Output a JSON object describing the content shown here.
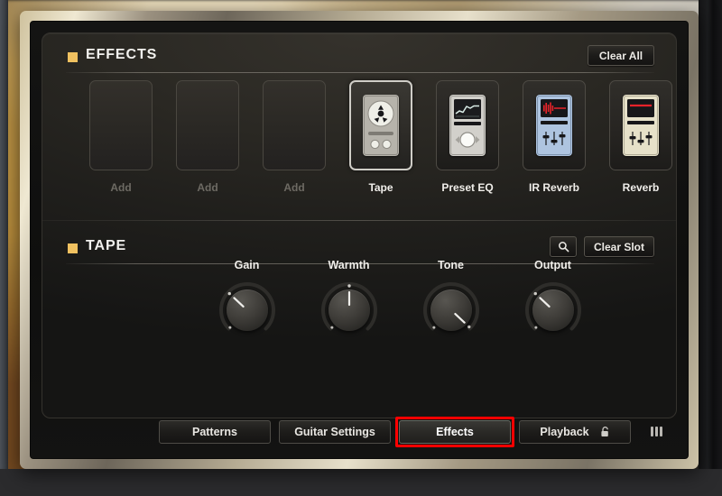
{
  "window": {
    "frame_color": "#cfc29e",
    "panel_bg": "#141413"
  },
  "effects_section": {
    "bullet_color": "#f0c160",
    "title": "EFFECTS",
    "clear_all_label": "Clear All",
    "slots": [
      {
        "label": "Add",
        "state": "empty",
        "icon": "empty-slot-icon"
      },
      {
        "label": "Add",
        "state": "empty",
        "icon": "empty-slot-icon"
      },
      {
        "label": "Add",
        "state": "empty",
        "icon": "empty-slot-icon"
      },
      {
        "label": "Tape",
        "state": "selected",
        "icon": "tape-pedal-icon"
      },
      {
        "label": "Preset EQ",
        "state": "filled",
        "icon": "preset-eq-pedal-icon"
      },
      {
        "label": "IR Reverb",
        "state": "filled",
        "icon": "ir-reverb-pedal-icon"
      },
      {
        "label": "Reverb",
        "state": "filled",
        "icon": "reverb-pedal-icon"
      }
    ]
  },
  "slot_section": {
    "bullet_color": "#f0c160",
    "title": "TAPE",
    "search_icon": "magnifier-icon",
    "clear_slot_label": "Clear Slot",
    "knobs": [
      {
        "label": "Gain",
        "angle": -47,
        "value_pct": 27
      },
      {
        "label": "Warmth",
        "angle": 0,
        "value_pct": 50
      },
      {
        "label": "Tone",
        "angle": 133,
        "value_pct": 94
      },
      {
        "label": "Output",
        "angle": -47,
        "value_pct": 27
      }
    ]
  },
  "tab_bar": {
    "tabs": [
      {
        "label": "Patterns",
        "width": 124,
        "active": false,
        "icon": ""
      },
      {
        "label": "Guitar Settings",
        "width": 124,
        "active": false,
        "icon": ""
      },
      {
        "label": "Effects",
        "width": 124,
        "active": true,
        "icon": ""
      },
      {
        "label": "Playback",
        "width": 124,
        "active": false,
        "icon": "lock-icon"
      }
    ],
    "keyboard_icon": "piano-keys-icon",
    "annotation_color": "#ff0000"
  }
}
